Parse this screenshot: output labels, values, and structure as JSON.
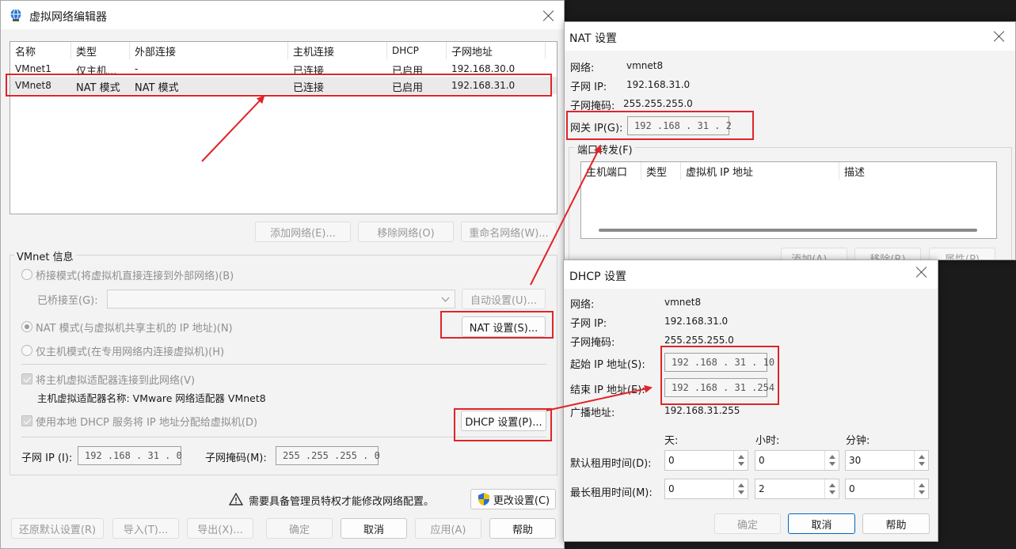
{
  "vne": {
    "title": "虚拟网络编辑器",
    "columns": [
      "名称",
      "类型",
      "外部连接",
      "主机连接",
      "DHCP",
      "子网地址"
    ],
    "rows": [
      [
        "VMnet1",
        "仅主机...",
        "-",
        "已连接",
        "已启用",
        "192.168.30.0"
      ],
      [
        "VMnet8",
        "NAT 模式",
        "NAT 模式",
        "已连接",
        "已启用",
        "192.168.31.0"
      ]
    ],
    "add_network": "添加网络(E)...",
    "remove_network": "移除网络(O)",
    "rename_network": "重命名网络(W)...",
    "vmnet_info": "VMnet 信息",
    "bridge_mode": "桥接模式(将虚拟机直接连接到外部网络)(B)",
    "bridged_to": "已桥接至(G):",
    "bridged_to_value": "",
    "auto_settings": "自动设置(U)...",
    "nat_mode": "NAT 模式(与虚拟机共享主机的 IP 地址)(N)",
    "nat_settings": "NAT 设置(S)...",
    "host_only_mode": "仅主机模式(在专用网络内连接虚拟机)(H)",
    "connect_adapter": "将主机虚拟适配器连接到此网络(V)",
    "adapter_name": "主机虚拟适配器名称: VMware 网络适配器 VMnet8",
    "use_dhcp": "使用本地 DHCP 服务将 IP 地址分配给虚拟机(D)",
    "dhcp_settings": "DHCP 设置(P)...",
    "subnet_ip_label": "子网 IP (I):",
    "subnet_ip": "192 .168 . 31 . 0",
    "subnet_mask_label": "子网掩码(M):",
    "subnet_mask": "255 .255 .255 . 0",
    "admin_notice": "需要具备管理员特权才能修改网络配置。",
    "change_settings": "更改设置(C)",
    "restore_defaults": "还原默认设置(R)",
    "import": "导入(T)...",
    "export": "导出(X)...",
    "ok": "确定",
    "cancel": "取消",
    "apply": "应用(A)",
    "help": "帮助"
  },
  "nat": {
    "title": "NAT 设置",
    "network_label": "网络:",
    "network": "vmnet8",
    "subnet_ip_label": "子网 IP:",
    "subnet_ip": "192.168.31.0",
    "subnet_mask_label": "子网掩码:",
    "subnet_mask": "255.255.255.0",
    "gateway_label": "网关 IP(G):",
    "gateway": "192 .168 . 31 . 2",
    "port_forward": "端口转发(F)",
    "columns": [
      "主机端口",
      "类型",
      "虚拟机 IP 地址",
      "描述"
    ],
    "add": "添加(A)...",
    "remove": "移除(R)",
    "properties": "属性(P)"
  },
  "dhcp": {
    "title": "DHCP 设置",
    "network_label": "网络:",
    "network": "vmnet8",
    "subnet_ip_label": "子网 IP:",
    "subnet_ip": "192.168.31.0",
    "subnet_mask_label": "子网掩码:",
    "subnet_mask": "255.255.255.0",
    "start_ip_label": "起始 IP 地址(S):",
    "start_ip": "192 .168 . 31 . 10",
    "end_ip_label": "结束 IP 地址(E):",
    "end_ip": "192 .168 . 31 .254",
    "broadcast_label": "广播地址:",
    "broadcast": "192.168.31.255",
    "days": "天:",
    "hours": "小时:",
    "minutes": "分钟:",
    "default_lease_label": "默认租用时间(D):",
    "default_lease": [
      "0",
      "0",
      "30"
    ],
    "max_lease_label": "最长租用时间(M):",
    "max_lease": [
      "0",
      "2",
      "0"
    ],
    "ok": "确定",
    "cancel": "取消",
    "help": "帮助"
  },
  "colors": {
    "annotation": "#e0242a",
    "accent": "#0067c0"
  }
}
